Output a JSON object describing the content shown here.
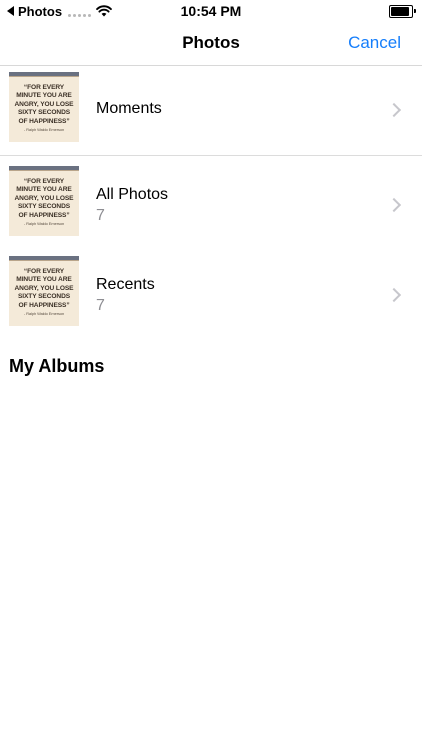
{
  "status_bar": {
    "back_app": "Photos",
    "time": "10:54 PM",
    "battery_level": 0.9
  },
  "nav": {
    "title": "Photos",
    "cancel_label": "Cancel"
  },
  "thumbnail_quote": {
    "lines": [
      "“FOR EVERY",
      "MINUTE YOU ARE",
      "ANGRY, YOU LOSE",
      "SIXTY SECONDS",
      "OF HAPPINESS”"
    ],
    "author": "- Ralph Waldo Emerson"
  },
  "albums": [
    {
      "name": "Moments",
      "count": ""
    },
    {
      "name": "All Photos",
      "count": "7"
    },
    {
      "name": "Recents",
      "count": "7"
    }
  ],
  "my_albums": {
    "heading": "My Albums"
  },
  "colors": {
    "accent": "#157efb",
    "secondary_text": "#8e8e93",
    "thumbnail_bg": "#f4ead9"
  }
}
